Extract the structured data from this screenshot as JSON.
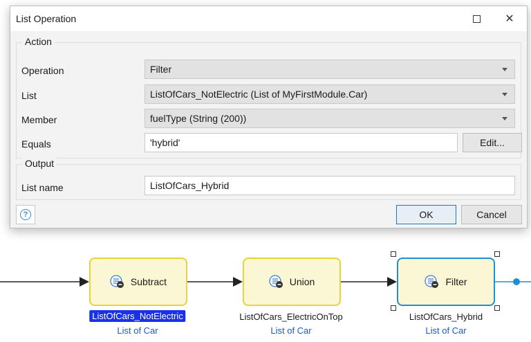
{
  "dialog": {
    "title": "List Operation",
    "action_group_label": "Action",
    "output_group_label": "Output",
    "operation": {
      "label": "Operation",
      "value": "Filter"
    },
    "list": {
      "label": "List",
      "value": "ListOfCars_NotElectric (List of MyFirstModule.Car)"
    },
    "member": {
      "label": "Member",
      "value": "fuelType (String (200))"
    },
    "equals": {
      "label": "Equals",
      "value": "'hybrid'",
      "edit_button": "Edit..."
    },
    "list_name": {
      "label": "List name",
      "value": "ListOfCars_Hybrid"
    },
    "ok_button": "OK",
    "cancel_button": "Cancel",
    "help_icon": "question-circle-icon"
  },
  "flow": {
    "activities": [
      {
        "label": "Subtract",
        "output": "ListOfCars_NotElectric",
        "type": "List of Car",
        "highlighted": true
      },
      {
        "label": "Union",
        "output": "ListOfCars_ElectricOnTop",
        "type": "List of Car"
      },
      {
        "label": "Filter",
        "output": "ListOfCars_Hybrid",
        "type": "List of Car",
        "selected": true
      }
    ],
    "colors": {
      "activity_border": "#e8d33c",
      "activity_fill": "#fbf6d3",
      "selected_border": "#1f8fd4",
      "highlight_bg": "#1a31e8",
      "caption_type": "#1f56d4"
    }
  }
}
